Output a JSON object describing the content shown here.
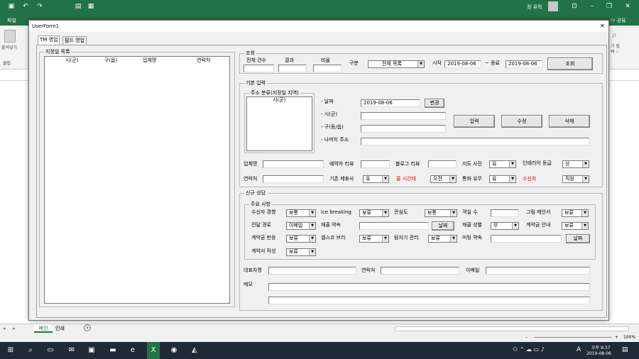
{
  "excel": {
    "title_user": "정 유욱",
    "tabs": [
      "파일",
      "",
      "",
      "",
      "",
      "",
      "",
      "",
      "",
      "",
      "",
      "",
      "",
      ""
    ],
    "share": "공유",
    "ribbon_left": [
      "붙여넣기",
      "클립"
    ],
    "ribbon_right": [
      "기 및",
      "택 ~"
    ],
    "sheet_tabs": [
      "메인",
      "인쇄"
    ],
    "add_sheet": "+",
    "zoom": "100%",
    "time": "오후 9:37",
    "date": "2019-08-06",
    "ime": "A"
  },
  "form": {
    "title": "UserForm1",
    "close": "✕",
    "tabs": [
      "TM 영업",
      "필드 영업"
    ],
    "list_frame": {
      "caption": "지정일 목록",
      "columns": [
        "시(군)",
        "구(읍)",
        "업체명",
        "연락처"
      ]
    },
    "query": {
      "caption": "조회",
      "total_label": "전체 건수",
      "result_label": "결과",
      "ratio_label": "비율",
      "category_label": "구분",
      "category_value": "전체 목록",
      "start_label": "시작",
      "start_value": "2019-08-06",
      "end_label": "~ 종료",
      "end_value": "2019-08-06",
      "search_button": "조회"
    },
    "basic": {
      "caption": "기본 입력",
      "addr_caption": "주소 분류(지정일 지역)",
      "addr_list_header": "시(군)",
      "date_label": "- 날짜",
      "date_value": "2019-08-06",
      "change_button": "변경",
      "city_label": "- 시(군)",
      "district_label": "- 구(동/읍)",
      "rest_label": "- 나머지 주소",
      "input_button": "입력",
      "edit_button": "수정",
      "delete_button": "삭제",
      "company_label": "업체명",
      "reservation_label": "예약자 리뷰",
      "blog_label": "블로그 리뷰",
      "map_photo_label": "지도 사진",
      "map_photo_value": "유",
      "interior_label": "인테리어 등급",
      "interior_value": "상",
      "contact_label": "연락처",
      "existing_label": "기존 제휴사",
      "existing_value": "유",
      "call_time_label": "콜 시간대",
      "call_time_value": "오전",
      "call_label": "통화 유무",
      "call_value": "유",
      "receiver_label": "수신자",
      "receiver_value": "직원"
    },
    "new": {
      "caption": "신규 상담",
      "major_caption": "주요 사항",
      "rows": [
        {
          "l1": "수신자 경향",
          "v1": "보통",
          "l2": "ice breaking",
          "v2": "보류",
          "l3": "관심도",
          "v3": "보통",
          "l4": "객실 수",
          "l5": "그림 제안서",
          "v5": "보류"
        },
        {
          "l1": "전달 경로",
          "v1": "이메일",
          "l2": "재콜 약속",
          "btn2": "날짜",
          "l3": "재콜 성별",
          "v3": "무",
          "l4": "계약금 안내",
          "v4": "보류"
        },
        {
          "l1": "계약금 반응",
          "v1": "보류",
          "l2": "셀스코 브리",
          "v2": "보류",
          "l3": "탐지기 관리",
          "v3": "보류",
          "l4": "미팅 약속",
          "btn4": "날짜"
        },
        {
          "l1": "계약서 작성",
          "v1": "보류"
        }
      ],
      "rep_label": "대표자명",
      "contact_label": "연락처",
      "email_label": "이메일",
      "memo_label": "메모"
    }
  }
}
